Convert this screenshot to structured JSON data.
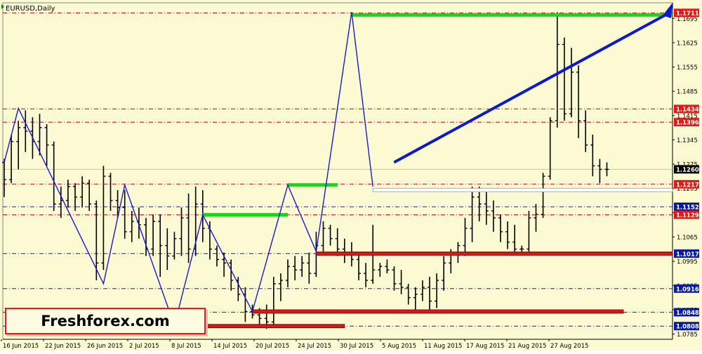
{
  "title": "EURUSD,Daily",
  "logo": "Freshforex.com",
  "colors": {
    "background": "#fbfad2",
    "bar": "#000000",
    "zigzag": "#1a1ad0",
    "arrow": "#0a1acc",
    "green_zone": "#19d519",
    "red_zone": "#d11a1a",
    "red_level": "#c4001c",
    "blue_level": "#1a1acc",
    "red_badge": "#e01a1a",
    "blue_badge": "#0a1aa0"
  },
  "chart_data": {
    "type": "ohlc",
    "symbol": "EURUSD",
    "timeframe": "Daily",
    "ylim": [
      1.077,
      1.174
    ],
    "x_labels": [
      "16 Jun 2015",
      "22 Jun 2015",
      "26 Jun 2015",
      "2 Jul 2015",
      "8 Jul 2015",
      "14 Jul 2015",
      "20 Jul 2015",
      "24 Jul 2015",
      "30 Jul 2015",
      "5 Aug 2015",
      "11 Aug 2015",
      "17 Aug 2015",
      "21 Aug 2015",
      "27 Aug 2015"
    ],
    "y_ticks": [
      "1.1695",
      "1.1625",
      "1.1555",
      "1.1485",
      "1.1415",
      "1.1345",
      "1.1275",
      "1.1205",
      "1.1135",
      "1.1065",
      "1.0995",
      "1.0925",
      "1.0855",
      "1.0785"
    ],
    "bars": [
      [
        1.128,
        1.129,
        1.118,
        1.123
      ],
      [
        1.123,
        1.136,
        1.122,
        1.134
      ],
      [
        1.134,
        1.14,
        1.126,
        1.138
      ],
      [
        1.138,
        1.143,
        1.131,
        1.137
      ],
      [
        1.137,
        1.141,
        1.129,
        1.134
      ],
      [
        1.134,
        1.142,
        1.13,
        1.138
      ],
      [
        1.138,
        1.139,
        1.127,
        1.133
      ],
      [
        1.133,
        1.134,
        1.114,
        1.116
      ],
      [
        1.116,
        1.121,
        1.112,
        1.117
      ],
      [
        1.117,
        1.123,
        1.115,
        1.121
      ],
      [
        1.121,
        1.122,
        1.114,
        1.118
      ],
      [
        1.118,
        1.124,
        1.115,
        1.122
      ],
      [
        1.122,
        1.123,
        1.114,
        1.116
      ],
      [
        1.116,
        1.117,
        1.094,
        1.099
      ],
      [
        1.099,
        1.127,
        1.097,
        1.124
      ],
      [
        1.124,
        1.125,
        1.114,
        1.117
      ],
      [
        1.117,
        1.12,
        1.112,
        1.115
      ],
      [
        1.115,
        1.12,
        1.106,
        1.108
      ],
      [
        1.108,
        1.114,
        1.105,
        1.111
      ],
      [
        1.111,
        1.115,
        1.106,
        1.11
      ],
      [
        1.11,
        1.112,
        1.101,
        1.103
      ],
      [
        1.103,
        1.113,
        1.101,
        1.111
      ],
      [
        1.111,
        1.113,
        1.095,
        1.104
      ],
      [
        1.104,
        1.109,
        1.097,
        1.101
      ],
      [
        1.101,
        1.108,
        1.1,
        1.106
      ],
      [
        1.106,
        1.115,
        1.101,
        1.112
      ],
      [
        1.112,
        1.119,
        1.099,
        1.103
      ],
      [
        1.103,
        1.121,
        1.101,
        1.116
      ],
      [
        1.116,
        1.12,
        1.105,
        1.109
      ],
      [
        1.109,
        1.111,
        1.1,
        1.103
      ],
      [
        1.103,
        1.104,
        1.098,
        1.1
      ],
      [
        1.1,
        1.102,
        1.095,
        1.099
      ],
      [
        1.099,
        1.1,
        1.091,
        1.094
      ],
      [
        1.094,
        1.095,
        1.088,
        1.09
      ],
      [
        1.09,
        1.092,
        1.082,
        1.085
      ],
      [
        1.085,
        1.087,
        1.083,
        1.084
      ],
      [
        1.084,
        1.086,
        1.081,
        1.083
      ],
      [
        1.083,
        1.087,
        1.08,
        1.082
      ],
      [
        1.082,
        1.095,
        1.081,
        1.093
      ],
      [
        1.093,
        1.096,
        1.088,
        1.094
      ],
      [
        1.094,
        1.1,
        1.092,
        1.098
      ],
      [
        1.098,
        1.101,
        1.094,
        1.097
      ],
      [
        1.097,
        1.101,
        1.095,
        1.099
      ],
      [
        1.099,
        1.102,
        1.093,
        1.096
      ],
      [
        1.096,
        1.108,
        1.095,
        1.104
      ],
      [
        1.104,
        1.111,
        1.102,
        1.109
      ],
      [
        1.109,
        1.11,
        1.104,
        1.106
      ],
      [
        1.106,
        1.109,
        1.101,
        1.103
      ],
      [
        1.103,
        1.106,
        1.099,
        1.102
      ],
      [
        1.102,
        1.105,
        1.098,
        1.1
      ],
      [
        1.1,
        1.102,
        1.094,
        1.096
      ],
      [
        1.096,
        1.099,
        1.092,
        1.094
      ],
      [
        1.094,
        1.11,
        1.093,
        1.097
      ],
      [
        1.097,
        1.099,
        1.095,
        1.098
      ],
      [
        1.098,
        1.1,
        1.096,
        1.097
      ],
      [
        1.097,
        1.098,
        1.091,
        1.093
      ],
      [
        1.093,
        1.097,
        1.09,
        1.092
      ],
      [
        1.092,
        1.093,
        1.087,
        1.089
      ],
      [
        1.089,
        1.092,
        1.085,
        1.09
      ],
      [
        1.09,
        1.094,
        1.088,
        1.092
      ],
      [
        1.092,
        1.095,
        1.085,
        1.088
      ],
      [
        1.088,
        1.096,
        1.086,
        1.094
      ],
      [
        1.094,
        1.101,
        1.091,
        1.099
      ],
      [
        1.099,
        1.103,
        1.096,
        1.102
      ],
      [
        1.102,
        1.105,
        1.099,
        1.104
      ],
      [
        1.104,
        1.112,
        1.101,
        1.109
      ],
      [
        1.109,
        1.121,
        1.105,
        1.118
      ],
      [
        1.118,
        1.121,
        1.111,
        1.116
      ],
      [
        1.116,
        1.12,
        1.11,
        1.114
      ],
      [
        1.114,
        1.117,
        1.108,
        1.112
      ],
      [
        1.112,
        1.113,
        1.105,
        1.108
      ],
      [
        1.108,
        1.111,
        1.103,
        1.105
      ],
      [
        1.105,
        1.11,
        1.102,
        1.103
      ],
      [
        1.103,
        1.104,
        1.102,
        1.103
      ],
      [
        1.103,
        1.114,
        1.102,
        1.112
      ],
      [
        1.112,
        1.116,
        1.108,
        1.113
      ],
      [
        1.113,
        1.125,
        1.112,
        1.124
      ],
      [
        1.124,
        1.141,
        1.123,
        1.14
      ],
      [
        1.14,
        1.1713,
        1.138,
        1.162
      ],
      [
        1.162,
        1.164,
        1.14,
        1.142
      ],
      [
        1.142,
        1.161,
        1.141,
        1.154
      ],
      [
        1.154,
        1.156,
        1.135,
        1.14
      ],
      [
        1.14,
        1.143,
        1.131,
        1.133
      ],
      [
        1.133,
        1.136,
        1.124,
        1.127
      ],
      [
        1.127,
        1.129,
        1.122,
        1.126
      ],
      [
        1.126,
        1.128,
        1.124,
        1.126
      ]
    ],
    "zigzag": [
      [
        "16 Jun 2015",
        1.128
      ],
      [
        "18 Jun 2015",
        1.1436
      ],
      [
        "6 Jul 2015",
        1.093
      ],
      [
        "9 Jul 2015",
        1.1215
      ],
      [
        "20 Jul 2015",
        1.081
      ],
      [
        "24 Jul 2015",
        1.1129
      ],
      [
        "4 Aug 2015",
        1.085
      ],
      [
        "11 Aug 2015",
        1.1215
      ],
      [
        "17 Aug 2015",
        1.1023
      ],
      [
        "24 Aug 2015",
        1.1713
      ],
      [
        "27 Aug 2015",
        1.121
      ]
    ],
    "levels": [
      {
        "price": 1.1711,
        "label": "1.1711",
        "color": "red"
      },
      {
        "price": 1.1434,
        "label": "1.1434",
        "color": "red"
      },
      {
        "price": 1.1396,
        "label": "1.1396",
        "color": "red"
      },
      {
        "price": 1.126,
        "label": "1.1260",
        "color": "current"
      },
      {
        "price": 1.1217,
        "label": "1.1217",
        "color": "red"
      },
      {
        "price": 1.1152,
        "label": "1.1152",
        "color": "blue"
      },
      {
        "price": 1.1129,
        "label": "1.1129",
        "color": "red"
      },
      {
        "price": 1.1017,
        "label": "1.1017",
        "color": "blue"
      },
      {
        "price": 1.0916,
        "label": "1.0916",
        "color": "blue"
      },
      {
        "price": 1.0848,
        "label": "1.0848",
        "color": "blue"
      },
      {
        "price": 1.0808,
        "label": "1.0808",
        "color": "blue"
      }
    ],
    "zones": [
      {
        "color": "green",
        "price": 1.1705,
        "from": "24 Aug 2015",
        "to": "right"
      },
      {
        "color": "green",
        "price": 1.1215,
        "from": "11 Aug 2015",
        "to": "20 Aug 2015"
      },
      {
        "color": "green",
        "price": 1.1129,
        "from": "24 Jul 2015",
        "to": "11 Aug 2015"
      },
      {
        "color": "white",
        "price": 1.12,
        "from": "27 Aug 2015",
        "to": "right"
      },
      {
        "color": "red",
        "price": 1.1017,
        "from": "17 Aug 2015",
        "to": "right"
      },
      {
        "color": "red",
        "price": 1.085,
        "from": "4 Aug 2015",
        "to": "end"
      },
      {
        "color": "red",
        "price": 1.0808,
        "from": "20 Jul 2015",
        "to": "21 Aug 2015"
      }
    ],
    "arrow": {
      "from": [
        "28 Aug 2015",
        1.127
      ],
      "to": [
        "right",
        1.174
      ]
    }
  }
}
